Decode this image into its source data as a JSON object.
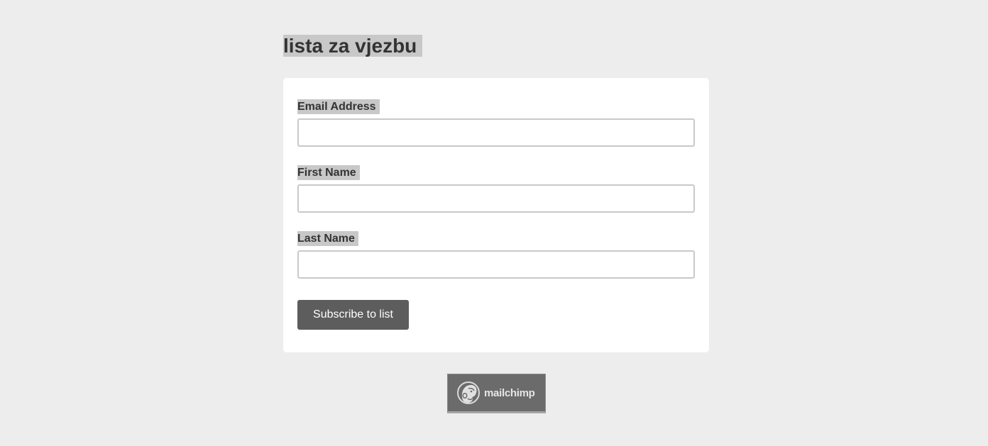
{
  "page": {
    "title": "lista za vjezbu"
  },
  "form": {
    "fields": [
      {
        "label": "Email Address",
        "value": "",
        "placeholder": ""
      },
      {
        "label": "First Name",
        "value": "",
        "placeholder": ""
      },
      {
        "label": "Last Name",
        "value": "",
        "placeholder": ""
      }
    ],
    "submit_label": "Subscribe to list"
  },
  "footer": {
    "badge_text": "mailchimp",
    "badge_icon": "mailchimp-monkey-icon"
  },
  "colors": {
    "background": "#ededed",
    "card": "#ffffff",
    "button": "#5d5d5d",
    "label_highlight": "#c8c8c8",
    "badge": "#6b6b6b"
  }
}
